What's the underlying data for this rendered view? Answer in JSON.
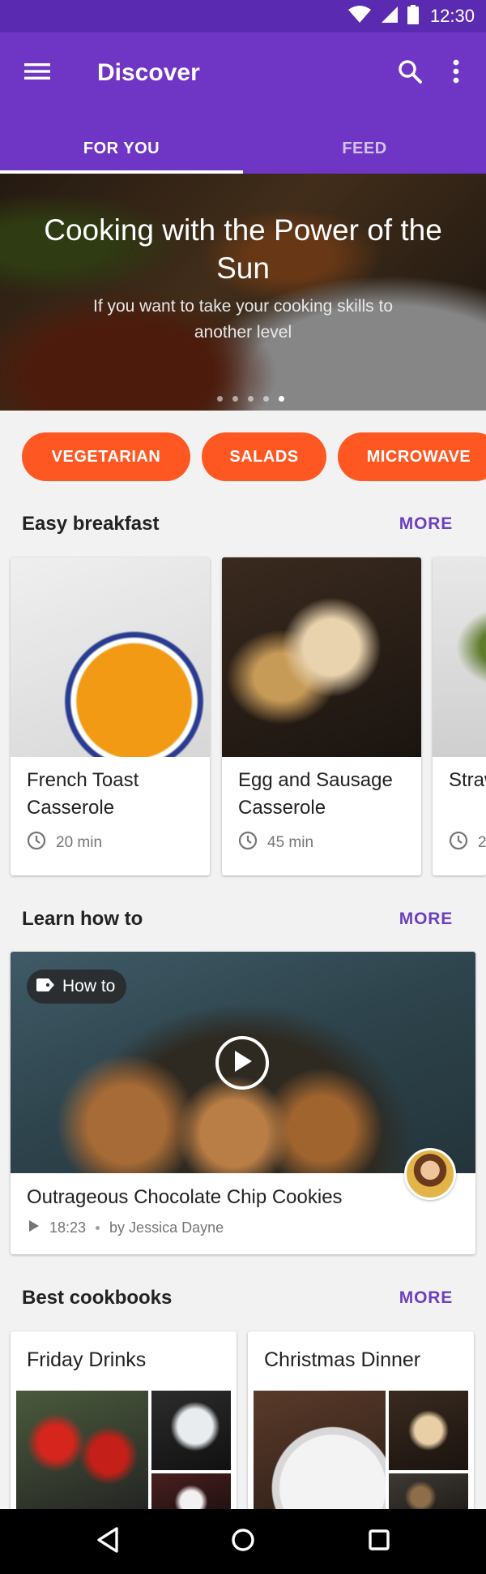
{
  "status_bar": {
    "time": "12:30",
    "icons": [
      "wifi-icon",
      "signal-icon",
      "battery-icon"
    ]
  },
  "app_bar": {
    "title": "Discover",
    "menu_icon": "menu-icon",
    "search_icon": "search-icon",
    "overflow_icon": "more-vert-icon"
  },
  "tabs": [
    {
      "label": "FOR YOU",
      "selected": true
    },
    {
      "label": "FEED",
      "selected": false
    }
  ],
  "hero": {
    "title": "Cooking with the Power of the Sun",
    "subtitle": "If you want to take your cooking skills to another level",
    "slide_count": 5,
    "active_slide": 5
  },
  "chips": [
    {
      "label": "VEGETARIAN"
    },
    {
      "label": "SALADS"
    },
    {
      "label": "MICROWAVE"
    }
  ],
  "sections": {
    "breakfast": {
      "title": "Easy breakfast",
      "more": "MORE"
    },
    "learn": {
      "title": "Learn how to",
      "more": "MORE"
    },
    "cookbooks": {
      "title": "Best cookbooks",
      "more": "MORE"
    }
  },
  "breakfast_cards": [
    {
      "title": "French Toast Casserole",
      "time": "20 min"
    },
    {
      "title": "Egg and Sausage Casserole",
      "time": "45 min"
    },
    {
      "title": "Strawberry Oatmeal",
      "time": "2"
    }
  ],
  "video": {
    "badge": "How to",
    "title": "Outrageous Chocolate Chip Cookies",
    "duration": "18:23",
    "author": "by Jessica Dayne"
  },
  "cookbooks": [
    {
      "title": "Friday Drinks"
    },
    {
      "title": "Christmas Dinner"
    }
  ],
  "colors": {
    "primary": "#6f35c4",
    "status_bar": "#5a2bb0",
    "accent": "#ff5722",
    "link": "#6b3fbd"
  }
}
